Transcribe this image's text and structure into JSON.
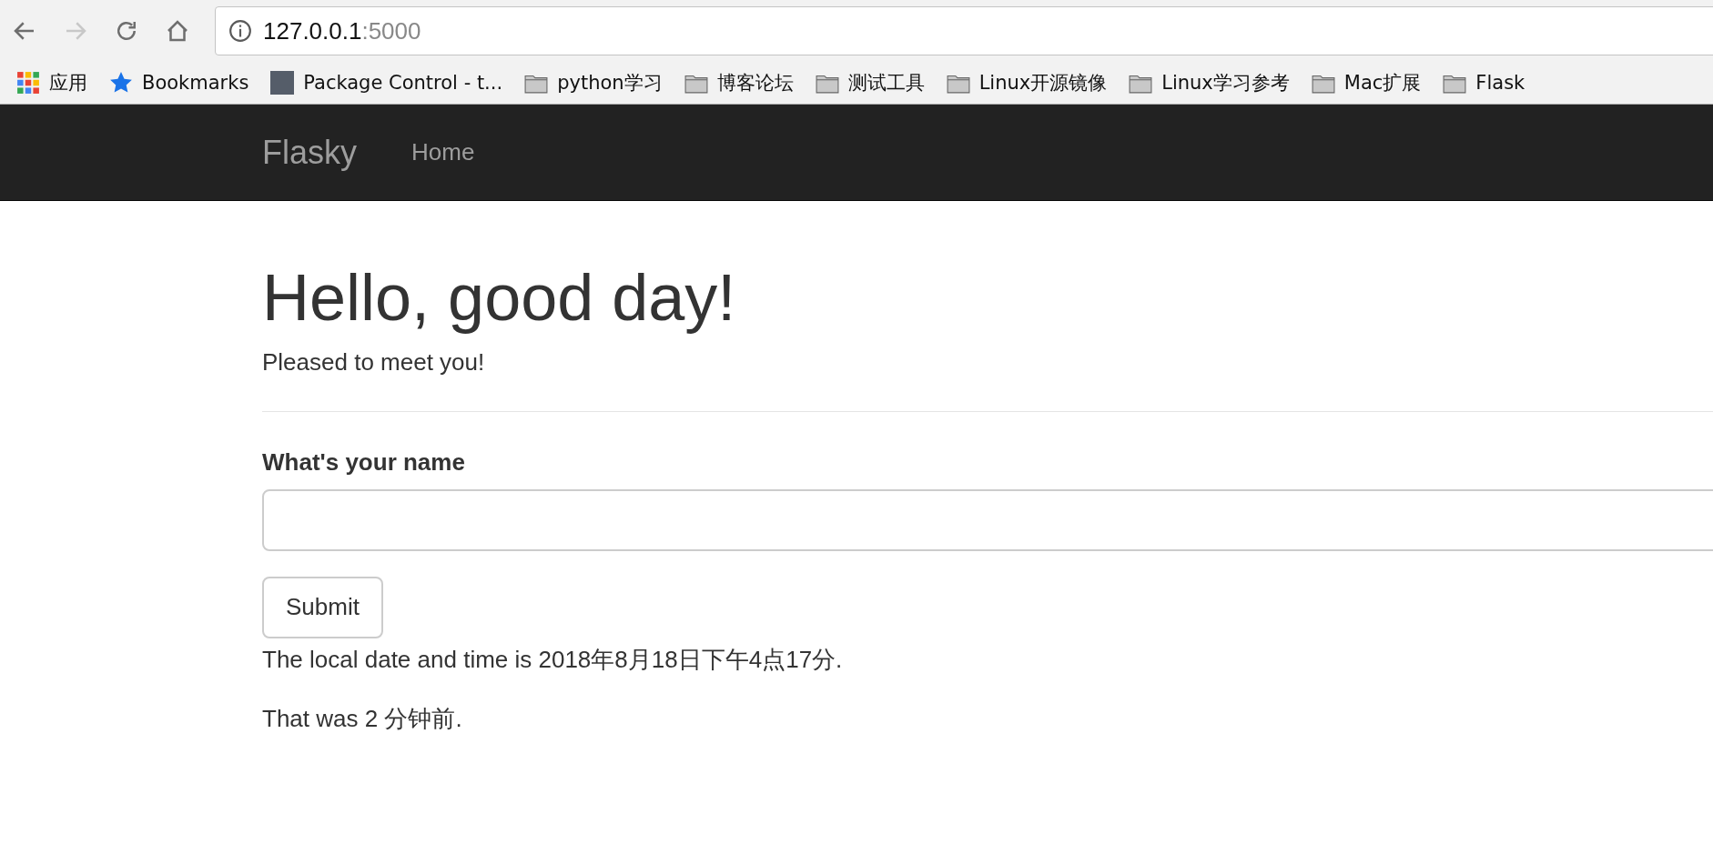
{
  "browser": {
    "nav_buttons": [
      {
        "kind": "back",
        "disabled": false
      },
      {
        "kind": "forward",
        "disabled": true
      },
      {
        "kind": "reload",
        "disabled": false
      },
      {
        "kind": "home",
        "disabled": false
      }
    ],
    "address": {
      "host": "127.0.0.1",
      "port": ":5000"
    },
    "bookmarks": [
      {
        "kind": "apps",
        "label": "应用"
      },
      {
        "kind": "star",
        "label": "Bookmarks"
      },
      {
        "kind": "page",
        "label": "Package Control - t..."
      },
      {
        "kind": "folder",
        "label": "python学习"
      },
      {
        "kind": "folder",
        "label": "博客论坛"
      },
      {
        "kind": "folder",
        "label": "测试工具"
      },
      {
        "kind": "folder",
        "label": "Linux开源镜像"
      },
      {
        "kind": "folder",
        "label": "Linux学习参考"
      },
      {
        "kind": "folder",
        "label": "Mac扩展"
      },
      {
        "kind": "folder",
        "label": "Flask"
      }
    ]
  },
  "navbar": {
    "brand": "Flasky",
    "links": [
      "Home"
    ]
  },
  "page": {
    "heading": "Hello, good day!",
    "subheading": "Pleased to meet you!",
    "form": {
      "label": "What's your name",
      "submit": "Submit"
    },
    "paragraphs": [
      "The local date and time is 2018年8月18日下午4点17分.",
      "That was 2 分钟前."
    ]
  }
}
